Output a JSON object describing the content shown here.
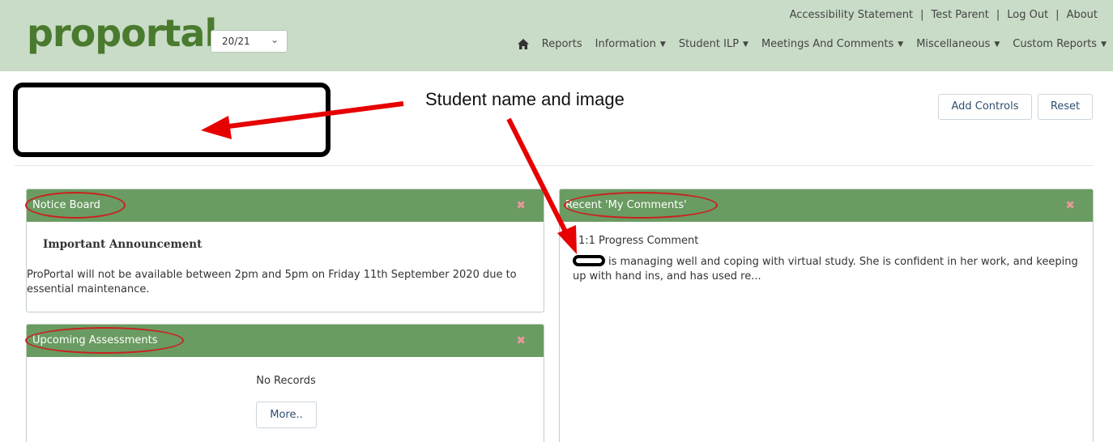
{
  "header": {
    "logo_text": "proportal",
    "year_select": "20/21",
    "top_links": [
      "Accessibility Statement",
      "Test Parent",
      "Log Out",
      "About"
    ],
    "separator": "|",
    "nav": [
      {
        "label": "Reports",
        "caret": false
      },
      {
        "label": "Information",
        "caret": true
      },
      {
        "label": "Student ILP",
        "caret": true
      },
      {
        "label": "Meetings And Comments",
        "caret": true
      },
      {
        "label": "Miscellaneous",
        "caret": true
      },
      {
        "label": "Custom Reports",
        "caret": true
      }
    ]
  },
  "annotation": {
    "text": "Student name and image",
    "color": "#e60000"
  },
  "toolbar": {
    "add_controls": "Add Controls",
    "reset": "Reset"
  },
  "notice_board": {
    "title": "Notice Board",
    "heading": "Important Announcement",
    "body": "ProPortal will not be available between 2pm and 5pm on Friday 11th September 2020 due to essential maintenance."
  },
  "upcoming_assessments": {
    "title": "Upcoming Assessments",
    "empty_text": "No Records",
    "more_label": "More.."
  },
  "recent_comments": {
    "title": "Recent 'My Comments'",
    "item_title": "1:1 Progress Comment",
    "item_body": "is managing well and coping with virtual study. She is confident in her work, and keeping up with hand ins, and has used re..."
  },
  "colors": {
    "header_bg": "#c9dcc7",
    "panel_header": "#6a9b62",
    "logo": "#4a7a2e",
    "close_icon": "#e59a9a",
    "annotation_circle": "#cc1f1f"
  }
}
